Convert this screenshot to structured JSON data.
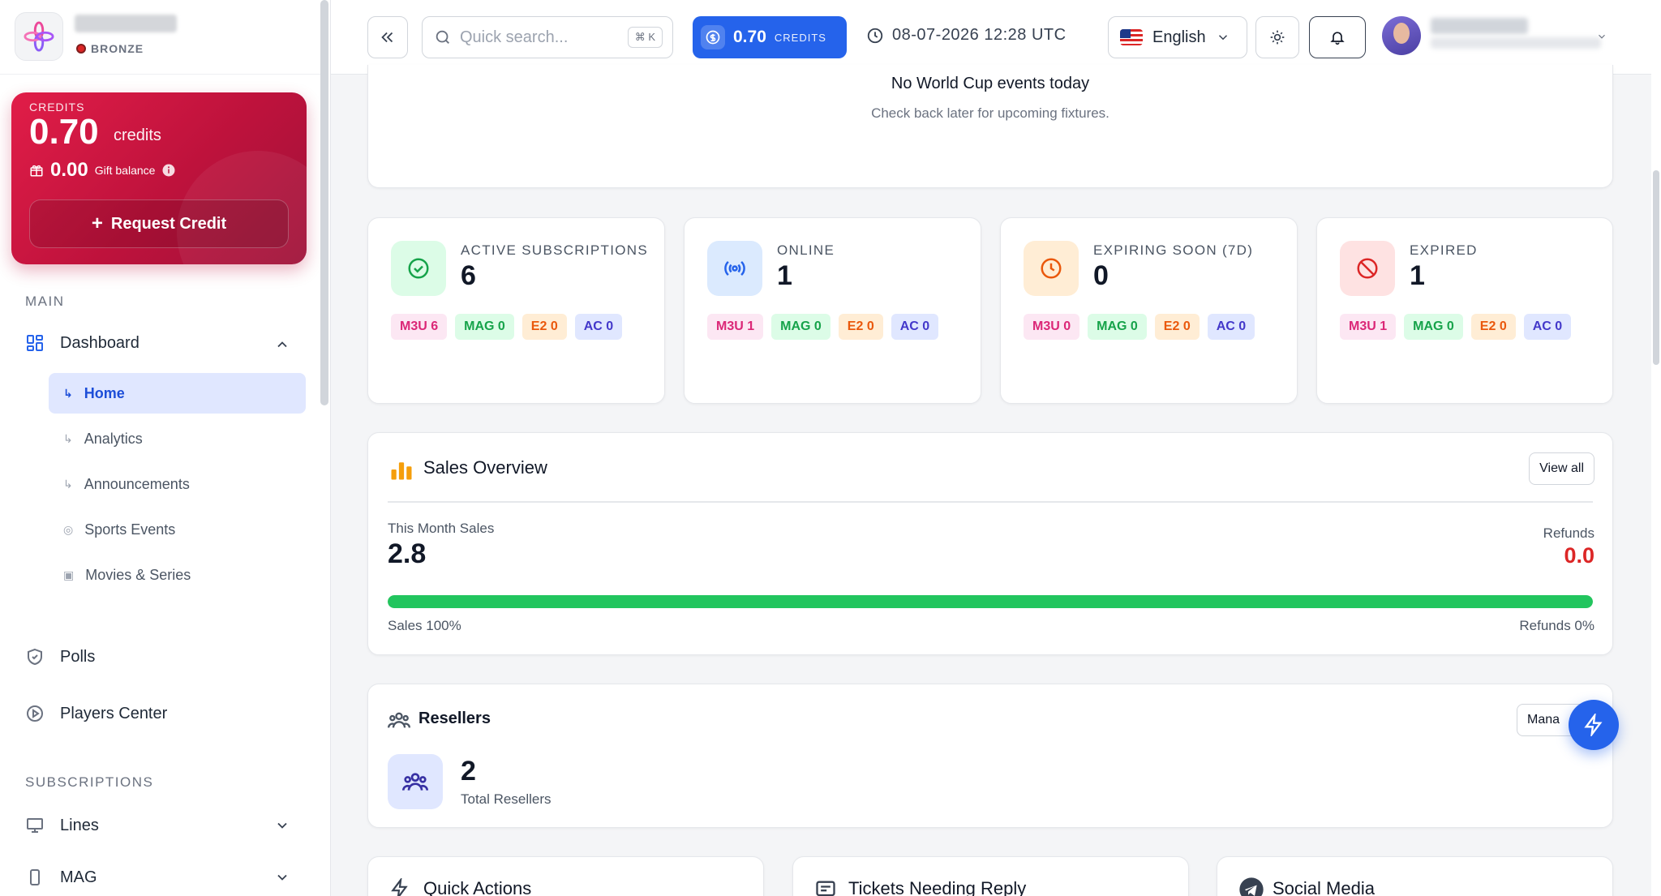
{
  "sidebar": {
    "tier": "BRONZE",
    "credits": {
      "label": "CREDITS",
      "amount": "0.70",
      "unit": "credits",
      "gift_amount": "0.00",
      "gift_label": "Gift balance",
      "request_label": "Request Credit"
    },
    "sections": {
      "main": "MAIN",
      "subscriptions": "SUBSCRIPTIONS"
    },
    "dashboard_label": "Dashboard",
    "dashboard_sub": [
      {
        "label": "Home",
        "active": true
      },
      {
        "label": "Analytics"
      },
      {
        "label": "Announcements"
      },
      {
        "label": "Sports Events"
      },
      {
        "label": "Movies & Series"
      }
    ],
    "polls_label": "Polls",
    "players_label": "Players Center",
    "lines_label": "Lines",
    "mag_label": "MAG"
  },
  "header": {
    "search_placeholder": "Quick search...",
    "search_shortcut": "⌘ K",
    "credits_value": "0.70",
    "credits_label": "CREDITS",
    "datetime": "08-07-2026 12:28 UTC",
    "language": "English"
  },
  "world_cup": {
    "title": "No World Cup events today",
    "subtitle": "Check back later for upcoming fixtures."
  },
  "stats": [
    {
      "label": "ACTIVE SUBSCRIPTIONS",
      "value": "6",
      "color": "#16a34a",
      "tags": {
        "m3u": "M3U 6",
        "mag": "MAG 0",
        "e2": "E2 0",
        "ac": "AC 0"
      }
    },
    {
      "label": "ONLINE",
      "value": "1",
      "color": "#2563eb",
      "tags": {
        "m3u": "M3U 1",
        "mag": "MAG 0",
        "e2": "E2 0",
        "ac": "AC 0"
      }
    },
    {
      "label": "EXPIRING SOON (7D)",
      "value": "0",
      "color": "#ea580c",
      "tags": {
        "m3u": "M3U 0",
        "mag": "MAG 0",
        "e2": "E2 0",
        "ac": "AC 0"
      }
    },
    {
      "label": "EXPIRED",
      "value": "1",
      "color": "#dc2626",
      "tags": {
        "m3u": "M3U 1",
        "mag": "MAG 0",
        "e2": "E2 0",
        "ac": "AC 0"
      }
    }
  ],
  "sales": {
    "title": "Sales Overview",
    "view_all": "View all",
    "month_label": "This Month Sales",
    "month_value": "2.8",
    "refunds_label": "Refunds",
    "refunds_value": "0.0",
    "sales_pct_label": "Sales 100%",
    "refunds_pct_label": "Refunds 0%",
    "sales_fraction": 1.0
  },
  "resellers": {
    "title": "Resellers",
    "manage_label": "Mana",
    "count": "2",
    "count_label": "Total Resellers"
  },
  "bottom_cards": {
    "quick_actions": "Quick Actions",
    "tickets": "Tickets Needing Reply",
    "social": "Social Media"
  }
}
